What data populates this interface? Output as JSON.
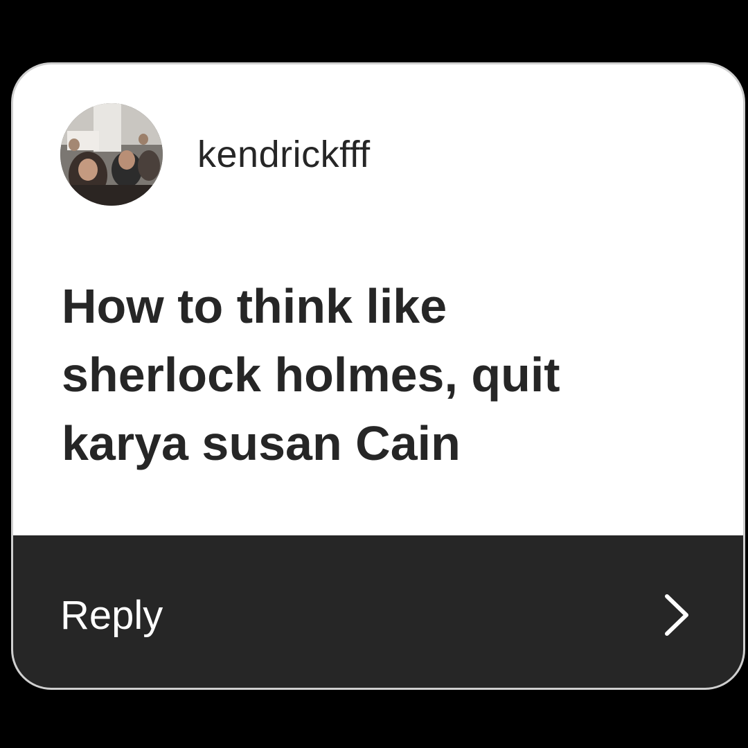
{
  "card": {
    "username": "kendrickfff",
    "question_lines": [
      "How to think like",
      "sherlock holmes, quit",
      "karya susan Cain"
    ],
    "reply_label": "Reply",
    "avatar_icon": "profile-photo",
    "chevron_icon": "chevron-right-icon"
  },
  "colors": {
    "page_background": "#000000",
    "card_background": "#ffffff",
    "text": "#262626",
    "reply_bar": "#262626",
    "reply_text": "#ffffff"
  }
}
